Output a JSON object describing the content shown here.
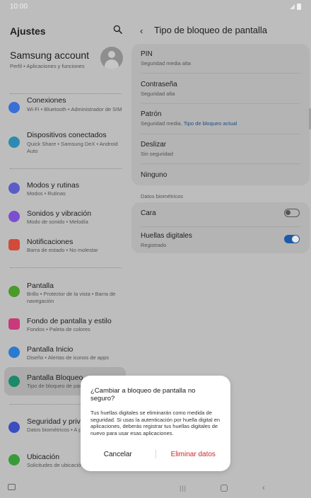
{
  "status_bar": {
    "time": "10:00"
  },
  "left_pane": {
    "title": "Ajustes",
    "account": {
      "name": "Samsung account",
      "sub": "Perfil • Aplicaciones y funciones"
    },
    "items": [
      {
        "label": "Conexiones",
        "sub": "Wi-Fi • Bluetooth • Administrador de SIM",
        "icon": "wifi-icon",
        "color": "#3a6fd8"
      },
      {
        "label": "Dispositivos conectados",
        "sub": "Quick Share • Samsung DeX • Android Auto",
        "icon": "devices-icon",
        "color": "#2d8ab0"
      },
      {
        "label": "Modos y rutinas",
        "sub": "Modos • Rutinas",
        "icon": "check-circle-icon",
        "color": "#5a5cc8"
      },
      {
        "label": "Sonidos y vibración",
        "sub": "Modo de sonido • Melodía",
        "icon": "speaker-icon",
        "color": "#7a4fd0"
      },
      {
        "label": "Notificaciones",
        "sub": "Barra de estado • No molestar",
        "icon": "notification-icon",
        "color": "#d24a3a"
      },
      {
        "label": "Pantalla",
        "sub": "Brillo • Protector de la vista • Barra de navegación",
        "icon": "sun-icon",
        "color": "#4a9a2c"
      },
      {
        "label": "Fondo de pantalla y estilo",
        "sub": "Fondos • Paleta de colores",
        "icon": "wallpaper-icon",
        "color": "#c83a7a"
      },
      {
        "label": "Pantalla Inicio",
        "sub": "Diseño • Alertas de iconos de apps",
        "icon": "home-icon",
        "color": "#2a7ad0"
      },
      {
        "label": "Pantalla Bloqueo",
        "sub": "Tipo de bloqueo de pantalla",
        "icon": "lock-icon",
        "color": "#1a8a6a"
      },
      {
        "label": "Seguridad y priva",
        "sub": "Datos biométricos • A permisos",
        "icon": "shield-icon",
        "color": "#3a4ec0"
      },
      {
        "label": "Ubicación",
        "sub": "Solicitudes de ubicació",
        "icon": "location-icon",
        "color": "#3a9a3a"
      }
    ]
  },
  "right_pane": {
    "title": "Tipo de bloqueo de pantalla",
    "options": [
      {
        "label": "PIN",
        "sub": "Seguridad media alta"
      },
      {
        "label": "Contraseña",
        "sub": "Seguridad alta"
      },
      {
        "label": "Patrón",
        "sub": "Seguridad media, ",
        "link": "Tipo de bloqueo actual"
      },
      {
        "label": "Deslizar",
        "sub": "Sin seguridad"
      },
      {
        "label": "Ninguno",
        "sub": ""
      }
    ],
    "biometrics_header": "Datos biométricos",
    "biometrics": [
      {
        "label": "Cara",
        "sub": "",
        "enabled": false
      },
      {
        "label": "Huellas digitales",
        "sub": "Registrado",
        "enabled": true
      }
    ]
  },
  "dialog": {
    "title": "¿Cambiar a bloqueo de pantalla no seguro?",
    "body": "Tus huellas digitales se eliminarán como medida de seguridad. Si usas la autenticación por huella digital en aplicaciones, deberás registrar tus huellas digitales de nuevo para usar esas aplicaciones.",
    "cancel": "Cancelar",
    "confirm": "Eliminar datos"
  },
  "colors": {
    "accent": "#1f5aa8",
    "destructive": "#c82828",
    "link": "#1f4c8c"
  }
}
